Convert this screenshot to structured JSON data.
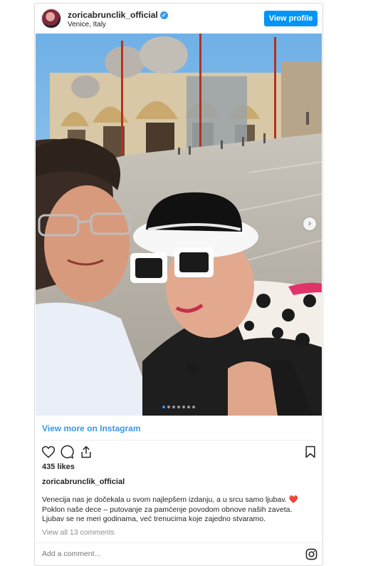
{
  "header": {
    "username": "zoricabrunclik_official",
    "verified_icon": "verified-badge-icon",
    "location": "Venice, Italy",
    "view_profile_label": "View profile"
  },
  "media": {
    "carousel_slide_count": 7,
    "carousel_active_index": 0
  },
  "view_more_label": "View more on Instagram",
  "actions": {
    "icons": [
      "heart-icon",
      "comment-icon",
      "share-icon",
      "bookmark-icon"
    ]
  },
  "likes": "435 likes",
  "caption": {
    "username": "zoricabrunclik_official",
    "line1": "Venecija nas je dočekala u svom najlepšem izdanju, a u srcu samo ljubav.",
    "line1_emoji": "❤️",
    "line2": "Poklon naše dece – putovanje za pamćenje povodom obnove naših zaveta.",
    "line3": "Ljubav se ne meri godinama, već trenucima koje zajedno stvaramo."
  },
  "comments_link": "View all 13 comments",
  "comment_input": {
    "placeholder": "Add a comment..."
  },
  "colors": {
    "accent": "#0095f6",
    "link": "#3897f0",
    "border": "#dbdbdb",
    "muted_text": "#8e8e8e"
  }
}
